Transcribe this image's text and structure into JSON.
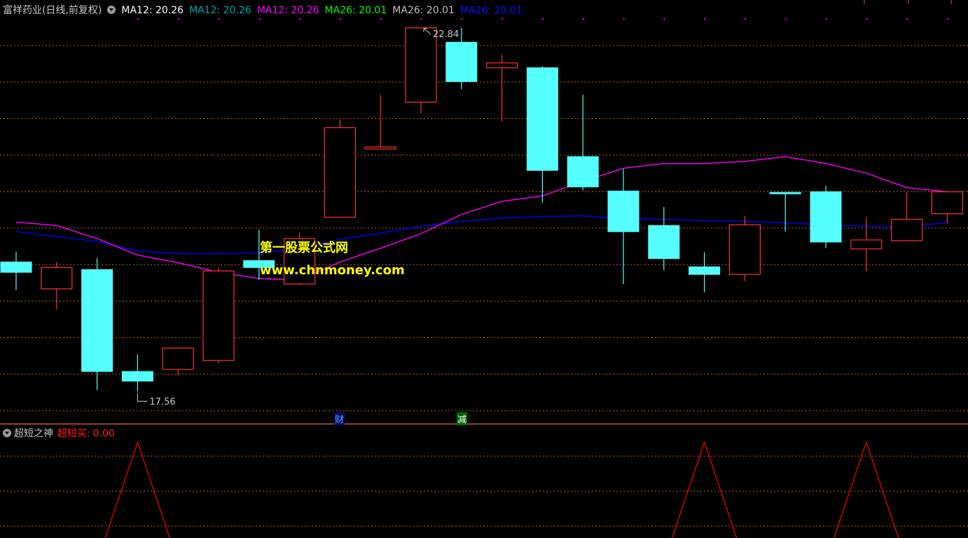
{
  "header": {
    "stock_name": "富祥药业(日线,前复权)",
    "indicators": [
      {
        "text": "MA12: 20.26",
        "color": "#ffffff"
      },
      {
        "text": "MA12: 20.26",
        "color": "#00a8a8"
      },
      {
        "text": "MA12: 20.26",
        "color": "#ff00ff"
      },
      {
        "text": "MA26: 20.01",
        "color": "#00ff00"
      },
      {
        "text": "MA26: 20.01",
        "color": "#c0c0c0"
      },
      {
        "text": "MA26: 20.01",
        "color": "#1010ff"
      }
    ]
  },
  "sub_header": {
    "name": "超短之神",
    "indicator_label": "超短买:",
    "indicator_value": "0.00"
  },
  "tags": {
    "cai": "财",
    "jian": "减"
  },
  "watermark": {
    "line1": "第一股票公式网",
    "line2": "www.chnmoney.com"
  },
  "colors": {
    "up": "#ff3232",
    "down": "#54ffff",
    "ma12": "#ff00ff",
    "ma26": "#0000ff",
    "grid": "#c0602a",
    "signal": "#ff0000"
  },
  "chart_data": {
    "type": "candlestick",
    "y_range": [
      17.2,
      23.0
    ],
    "high_label": "22.84",
    "low_label": "17.56",
    "candles": [
      {
        "o": 19.44,
        "h": 19.59,
        "l": 19.03,
        "c": 19.29
      },
      {
        "o": 19.05,
        "h": 19.44,
        "l": 18.75,
        "c": 19.36
      },
      {
        "o": 19.33,
        "h": 19.5,
        "l": 17.58,
        "c": 17.85
      },
      {
        "o": 17.85,
        "h": 18.1,
        "l": 17.56,
        "c": 17.71
      },
      {
        "o": 17.88,
        "h": 18.19,
        "l": 17.79,
        "c": 18.19
      },
      {
        "o": 18.01,
        "h": 19.36,
        "l": 17.97,
        "c": 19.31
      },
      {
        "o": 19.46,
        "h": 19.91,
        "l": 19.18,
        "c": 19.36
      },
      {
        "o": 19.12,
        "h": 19.87,
        "l": 19.1,
        "c": 19.78
      },
      {
        "o": 20.09,
        "h": 21.51,
        "l": 20.09,
        "c": 21.39
      },
      {
        "o": 21.08,
        "h": 21.87,
        "l": 21.12,
        "c": 21.11
      },
      {
        "o": 21.76,
        "h": 22.84,
        "l": 21.6,
        "c": 22.84
      },
      {
        "o": 22.63,
        "h": 22.84,
        "l": 21.95,
        "c": 22.06
      },
      {
        "o": 22.26,
        "h": 22.45,
        "l": 21.48,
        "c": 22.33
      },
      {
        "o": 22.26,
        "h": 22.28,
        "l": 20.3,
        "c": 20.77
      },
      {
        "o": 20.97,
        "h": 21.87,
        "l": 20.48,
        "c": 20.53
      },
      {
        "o": 20.47,
        "h": 20.79,
        "l": 19.12,
        "c": 19.88
      },
      {
        "o": 19.97,
        "h": 20.24,
        "l": 19.32,
        "c": 19.49
      },
      {
        "o": 19.37,
        "h": 19.58,
        "l": 19.0,
        "c": 19.26
      },
      {
        "o": 19.26,
        "h": 20.11,
        "l": 19.16,
        "c": 19.98
      },
      {
        "o": 20.45,
        "h": 20.44,
        "l": 19.88,
        "c": 20.43
      },
      {
        "o": 20.46,
        "h": 20.55,
        "l": 19.64,
        "c": 19.73
      },
      {
        "o": 19.63,
        "h": 20.09,
        "l": 19.3,
        "c": 19.76
      },
      {
        "o": 19.75,
        "h": 20.46,
        "l": 19.75,
        "c": 20.06
      },
      {
        "o": 20.14,
        "h": 20.37,
        "l": 20.0,
        "c": 20.46
      }
    ],
    "ma12": [
      20.02,
      19.97,
      19.78,
      19.54,
      19.43,
      19.29,
      19.2,
      19.18,
      19.44,
      19.64,
      19.85,
      20.13,
      20.32,
      20.4,
      20.61,
      20.8,
      20.87,
      20.87,
      20.9,
      20.97,
      20.87,
      20.73,
      20.52,
      20.46
    ],
    "ma26": [
      19.88,
      19.81,
      19.74,
      19.6,
      19.56,
      19.56,
      19.57,
      19.64,
      19.77,
      19.86,
      19.96,
      20.03,
      20.08,
      20.1,
      20.11,
      20.07,
      20.06,
      20.04,
      20.03,
      20.01,
      19.98,
      19.96,
      19.96,
      20.01
    ],
    "signal_peaks": [
      3,
      17,
      21
    ]
  }
}
